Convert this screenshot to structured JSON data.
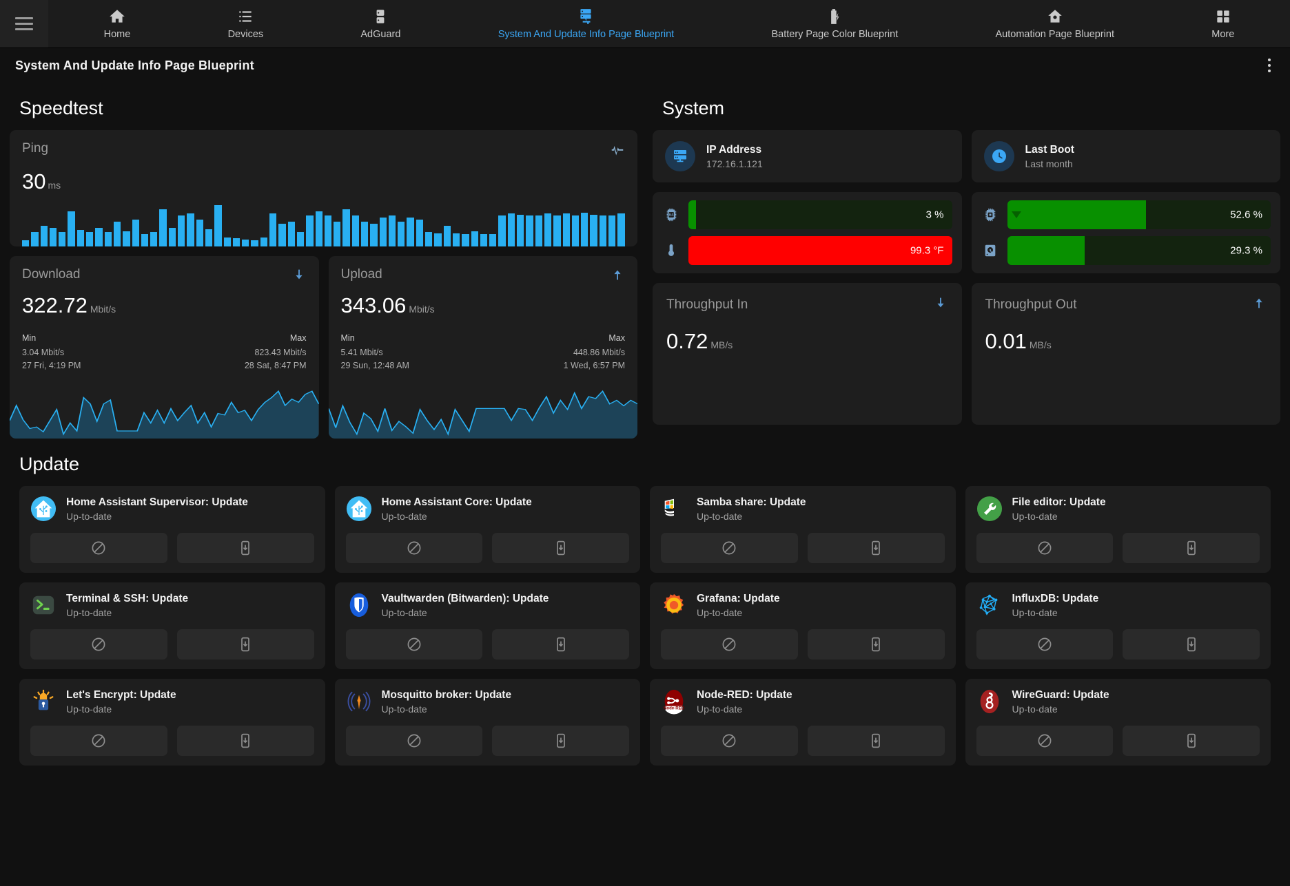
{
  "nav": {
    "menu_icon": "hamburger-icon",
    "items": [
      {
        "label": "Home",
        "icon": "home-icon",
        "active": false
      },
      {
        "label": "Devices",
        "icon": "list-icon",
        "active": false
      },
      {
        "label": "AdGuard",
        "icon": "server-icon",
        "active": false
      },
      {
        "label": "System And Update Info Page Blueprint",
        "icon": "server-network-icon",
        "active": true
      },
      {
        "label": "Battery Page Color Blueprint",
        "icon": "battery-charging-icon",
        "active": false
      },
      {
        "label": "Automation Page Blueprint",
        "icon": "home-automation-icon",
        "active": false
      },
      {
        "label": "More",
        "icon": "grid-icon",
        "active": false
      }
    ]
  },
  "header": {
    "title": "System And Update Info Page Blueprint",
    "overflow_icon": "dots-vertical-icon"
  },
  "accent": "#3ba7f5",
  "speedtest": {
    "section_title": "Speedtest",
    "ping": {
      "name": "Ping",
      "value": "30",
      "unit": "ms",
      "icon": "pulse-icon"
    },
    "download": {
      "title": "Download",
      "icon": "arrow-down-icon",
      "value": "322.72",
      "unit": "Mbit/s",
      "min_label": "Min",
      "max_label": "Max",
      "min_value": "3.04 Mbit/s",
      "min_time": "27 Fri, 4:19 PM",
      "max_value": "823.43 Mbit/s",
      "max_time": "28 Sat, 8:47 PM"
    },
    "upload": {
      "title": "Upload",
      "icon": "arrow-up-icon",
      "value": "343.06",
      "unit": "Mbit/s",
      "min_label": "Min",
      "max_label": "Max",
      "min_value": "5.41 Mbit/s",
      "min_time": "29 Sun, 12:48 AM",
      "max_value": "448.86 Mbit/s",
      "max_time": "1 Wed, 6:57 PM"
    }
  },
  "system": {
    "section_title": "System",
    "ip": {
      "title": "IP Address",
      "value": "172.16.1.121",
      "icon": "server-icon"
    },
    "boot": {
      "title": "Last Boot",
      "value": "Last month",
      "icon": "clock-icon"
    },
    "gauges": [
      {
        "name": "processor",
        "icon": "cpu-64-icon",
        "value": "3 %",
        "percent": 3,
        "color": "#089000",
        "marker": false
      },
      {
        "name": "memory",
        "icon": "memory-icon",
        "value": "52.6 %",
        "percent": 52.6,
        "color": "#089000",
        "marker": true
      },
      {
        "name": "temperature",
        "icon": "thermometer-icon",
        "value": "99.3 °F",
        "percent": 100,
        "color": "#ff0000",
        "marker": false
      },
      {
        "name": "disk",
        "icon": "harddisk-icon",
        "value": "29.3 %",
        "percent": 29.3,
        "color": "#089000",
        "marker": false
      }
    ],
    "throughput_in": {
      "title": "Throughput In",
      "icon": "arrow-down-icon",
      "value": "0.72",
      "unit": "MB/s"
    },
    "throughput_out": {
      "title": "Throughput Out",
      "icon": "arrow-up-icon",
      "value": "0.01",
      "unit": "MB/s"
    }
  },
  "update": {
    "section_title": "Update",
    "skip_icon": "block-icon",
    "install_icon": "cellphone-arrow-down-icon",
    "items": [
      {
        "title": "Home Assistant Supervisor: Update",
        "status": "Up-to-date",
        "icon": "home-assistant-icon"
      },
      {
        "title": "Home Assistant Core: Update",
        "status": "Up-to-date",
        "icon": "home-assistant-icon"
      },
      {
        "title": "Samba share: Update",
        "status": "Up-to-date",
        "icon": "samba-icon"
      },
      {
        "title": "File editor: Update",
        "status": "Up-to-date",
        "icon": "file-editor-icon"
      },
      {
        "title": "Terminal & SSH: Update",
        "status": "Up-to-date",
        "icon": "terminal-icon"
      },
      {
        "title": "Vaultwarden (Bitwarden): Update",
        "status": "Up-to-date",
        "icon": "vaultwarden-icon"
      },
      {
        "title": "Grafana: Update",
        "status": "Up-to-date",
        "icon": "grafana-icon"
      },
      {
        "title": "InfluxDB: Update",
        "status": "Up-to-date",
        "icon": "influxdb-icon"
      },
      {
        "title": "Let's Encrypt: Update",
        "status": "Up-to-date",
        "icon": "lets-encrypt-icon"
      },
      {
        "title": "Mosquitto broker: Update",
        "status": "Up-to-date",
        "icon": "mosquitto-icon"
      },
      {
        "title": "Node-RED: Update",
        "status": "Up-to-date",
        "icon": "node-red-icon"
      },
      {
        "title": "WireGuard: Update",
        "status": "Up-to-date",
        "icon": "wireguard-icon"
      }
    ]
  },
  "chart_data": [
    {
      "type": "bar",
      "title": "Ping",
      "ylabel": "ms",
      "color": "#29b0f2",
      "values": [
        6,
        14,
        20,
        18,
        14,
        34,
        16,
        14,
        18,
        14,
        24,
        15,
        26,
        12,
        14,
        36,
        18,
        30,
        32,
        26,
        17,
        40,
        9,
        8,
        7,
        6,
        9,
        32,
        22,
        24,
        14,
        30,
        34,
        30,
        24,
        36,
        30,
        24,
        22,
        28,
        30,
        24,
        28,
        26,
        14,
        13,
        20,
        13,
        12,
        15,
        12,
        12,
        30,
        32,
        31,
        30,
        30,
        32,
        30,
        32,
        30,
        33,
        31,
        30,
        30,
        32
      ]
    },
    {
      "type": "area",
      "title": "Download",
      "ylabel": "Mbit/s",
      "color": "#29b0f2",
      "values": [
        330,
        520,
        340,
        230,
        250,
        190,
        330,
        470,
        160,
        300,
        200,
        620,
        540,
        320,
        540,
        590,
        200,
        200,
        200,
        200,
        430,
        300,
        460,
        300,
        480,
        330,
        430,
        520,
        300,
        430,
        250,
        420,
        400,
        560,
        430,
        460,
        330,
        470,
        560,
        620,
        700,
        520,
        600,
        560,
        660,
        700,
        540
      ]
    },
    {
      "type": "area",
      "title": "Upload",
      "ylabel": "Mbit/s",
      "color": "#29b0f2",
      "values": [
        430,
        220,
        460,
        280,
        150,
        380,
        320,
        180,
        430,
        190,
        290,
        230,
        160,
        420,
        300,
        200,
        310,
        150,
        420,
        300,
        180,
        430,
        430,
        430,
        430,
        430,
        300,
        430,
        420,
        300,
        440,
        560,
        380,
        520,
        420,
        600,
        430,
        560,
        540,
        620,
        480,
        520,
        460,
        520,
        480
      ]
    }
  ]
}
